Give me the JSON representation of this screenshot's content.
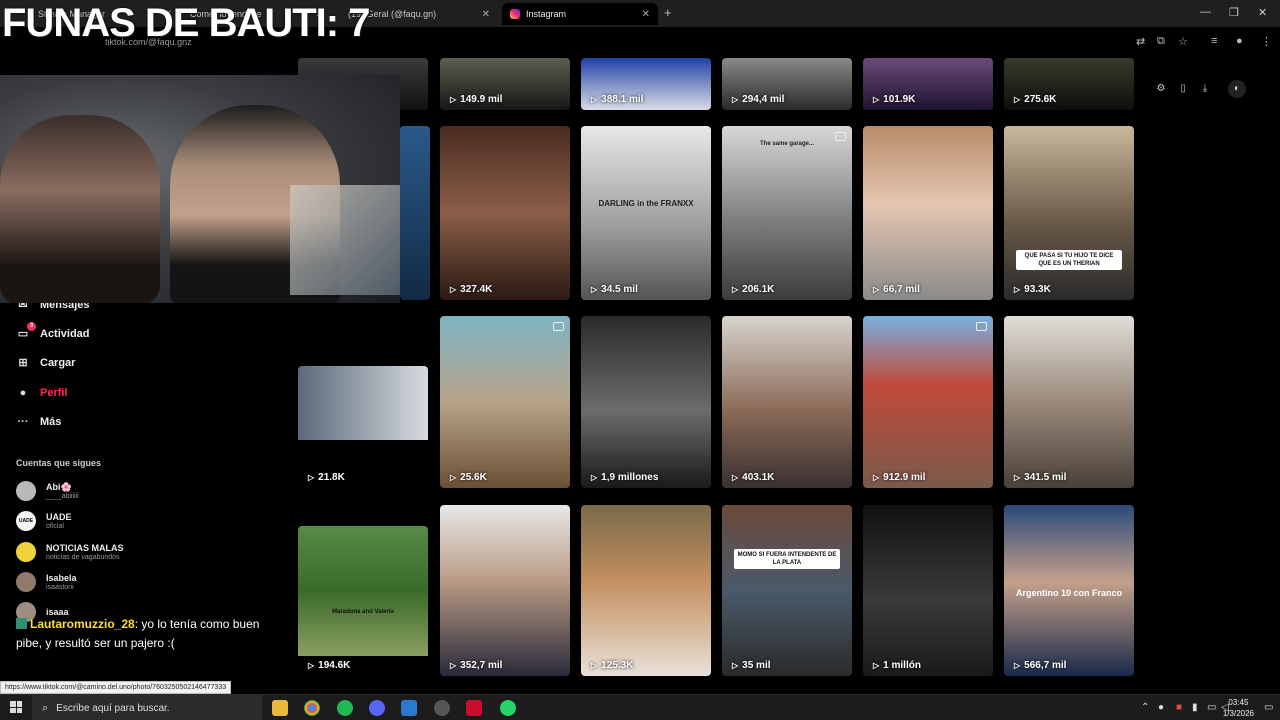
{
  "overlay_title": "FUNAS DE BAUTI: 7",
  "browser": {
    "tabs": [
      {
        "label": "Stream Manager"
      },
      {
        "label": "Como no rendirse"
      },
      {
        "label": "(19) Geral (@faqu.gn)"
      },
      {
        "label": "Instagram"
      }
    ],
    "new_tab": "+",
    "url": "tiktok.com/@faqu.gnz"
  },
  "sidebar": {
    "nav": [
      {
        "label": "Mensajes",
        "icon": "message-icon"
      },
      {
        "label": "Actividad",
        "icon": "activity-icon",
        "badge": "3"
      },
      {
        "label": "Cargar",
        "icon": "upload-icon"
      },
      {
        "label": "Perfil",
        "icon": "profile-icon"
      },
      {
        "label": "Más",
        "icon": "more-icon"
      }
    ],
    "following_title": "Cuentas que sigues",
    "following": [
      {
        "name": "Abi🌸",
        "handle": "____abiiiiii",
        "color": "#b9b9b9"
      },
      {
        "name": "UADE",
        "handle": "oficial",
        "color": "#f5f5f5"
      },
      {
        "name": "NOTICIAS MALAS",
        "handle": "noticias de vagabundos",
        "color": "#f2d23b"
      },
      {
        "name": "Isabela",
        "handle": "isaastorii",
        "color": "#8f7a6c"
      },
      {
        "name": "isaaa",
        "handle": "",
        "color": "#9d8d80"
      }
    ]
  },
  "chat": {
    "user": "Lautaromuzzio_28",
    "message": ": yo lo tenía como buen pibe, y resultó ser un pajero :("
  },
  "videos": [
    {
      "views": "149.9 mil"
    },
    {
      "views": "388.1 mil"
    },
    {
      "views": "294,4 mil"
    },
    {
      "views": "101.9K"
    },
    {
      "views": "275.6K"
    },
    {
      "views": "327.4K"
    },
    {
      "views": "34.5 mil",
      "caption": "DARLING in the FRANXX"
    },
    {
      "views": "206.1K",
      "caption": "The same garage..."
    },
    {
      "views": "66,7 mil"
    },
    {
      "views": "93.3K",
      "caption": "QUE PASA SI TU HIJO TE DICE QUE ES UN THERIAN"
    },
    {
      "views": "21.8K"
    },
    {
      "views": "25.6K"
    },
    {
      "views": "1,9 millones"
    },
    {
      "views": "403.1K"
    },
    {
      "views": "912.9 mil"
    },
    {
      "views": "341.5 mil"
    },
    {
      "views": "194.6K",
      "caption": "Maradona and Valeria"
    },
    {
      "views": "352,7 mil"
    },
    {
      "views": "125.3K"
    },
    {
      "views": "35 mil",
      "caption": "MOMO SI FUERA INTENDENTE DE LA PLATA"
    },
    {
      "views": "1 millón"
    },
    {
      "views": "566,7 mil",
      "caption": "Argentino 10 con Franco"
    }
  ],
  "status_url": "https://www.tiktok.com/@camino.del.uno/photo/7603250502146477333",
  "taskbar": {
    "search_placeholder": "Escribe aquí para buscar.",
    "time": "03:45",
    "date": "1/3/2026"
  }
}
